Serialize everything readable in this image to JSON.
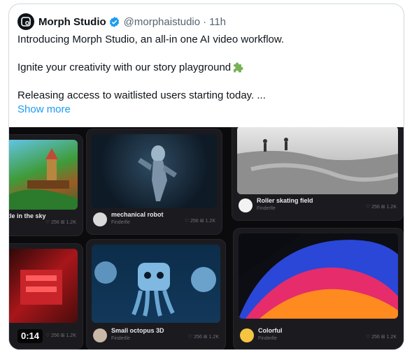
{
  "tweet": {
    "display_name": "Morph Studio",
    "handle": "@morphaistudio",
    "separator": "·",
    "timestamp": "11h",
    "line1": "Introducing Morph Studio, an all-in one AI video workflow.",
    "line2": "Ignite your creativity with our story playground",
    "line3": "Releasing access to waitlisted users starting today. ...",
    "show_more": "Show more",
    "avatar_icon": "morph-logo-icon",
    "verified_icon": "verified-badge-icon",
    "emoji_icon": "puzzle-piece-icon",
    "accent_color": "#1d9bf0"
  },
  "video": {
    "duration": "0:14",
    "tiles": [
      {
        "title": "tle in the sky",
        "author": "",
        "likes": "256",
        "views": "1.2K"
      },
      {
        "title": "mechanical robot",
        "author": "Finderlle",
        "likes": "256",
        "views": "1.2K"
      },
      {
        "title": "Roller skating field",
        "author": "Finderlle",
        "likes": "256",
        "views": "1.2K"
      },
      {
        "title": "",
        "author": "",
        "likes": "256",
        "views": "1.2K"
      },
      {
        "title": "Small octopus 3D",
        "author": "Finderlle",
        "likes": "256",
        "views": "1.2K"
      },
      {
        "title": "Colorful",
        "author": "Finderlle",
        "likes": "256",
        "views": "1.2K"
      }
    ]
  }
}
